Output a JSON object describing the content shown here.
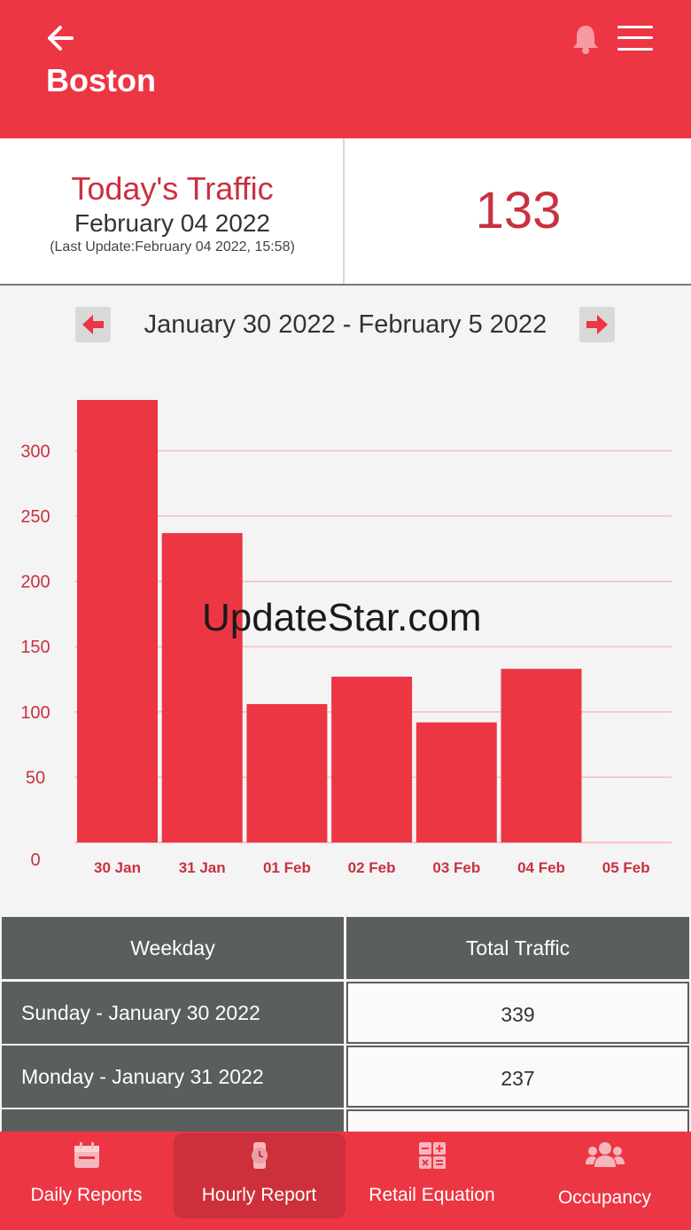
{
  "header": {
    "title": "Boston",
    "icons": {
      "back": "back-arrow-icon",
      "bell": "bell-icon",
      "menu": "hamburger-menu-icon"
    }
  },
  "today": {
    "title": "Today's Traffic",
    "date": "February 04 2022",
    "last_update": "(Last Update:February 04 2022, 15:58)",
    "count": "133"
  },
  "week_nav": {
    "range": "January 30 2022 - February 5 2022",
    "prev_icon": "arrow-left-icon",
    "next_icon": "arrow-right-icon"
  },
  "chart_data": {
    "type": "bar",
    "categories": [
      "30 Jan",
      "31 Jan",
      "01 Feb",
      "02 Feb",
      "03 Feb",
      "04 Feb",
      "05 Feb"
    ],
    "values": [
      339,
      237,
      106,
      127,
      92,
      133,
      0
    ],
    "yticks": [
      0,
      50,
      100,
      150,
      200,
      250,
      300
    ],
    "ylim": [
      0,
      339
    ],
    "color": "#ec3644",
    "grid": true
  },
  "watermark": "UpdateStar.com",
  "table": {
    "headers": [
      "Weekday",
      "Total Traffic"
    ],
    "rows": [
      {
        "weekday": "Sunday - January 30 2022",
        "traffic": "339"
      },
      {
        "weekday": "Monday - January 31 2022",
        "traffic": "237"
      }
    ]
  },
  "bottom_nav": [
    {
      "label": "Daily Reports",
      "icon": "calendar-icon",
      "active": false
    },
    {
      "label": "Hourly Report",
      "icon": "watch-icon",
      "active": true
    },
    {
      "label": "Retail Equation",
      "icon": "calculator-icon",
      "active": false
    },
    {
      "label": "Occupancy",
      "icon": "people-icon",
      "active": false
    }
  ],
  "colors": {
    "accent": "#ec3644",
    "dark_text_red": "#c8313f",
    "table_header": "#5b5e5e"
  }
}
